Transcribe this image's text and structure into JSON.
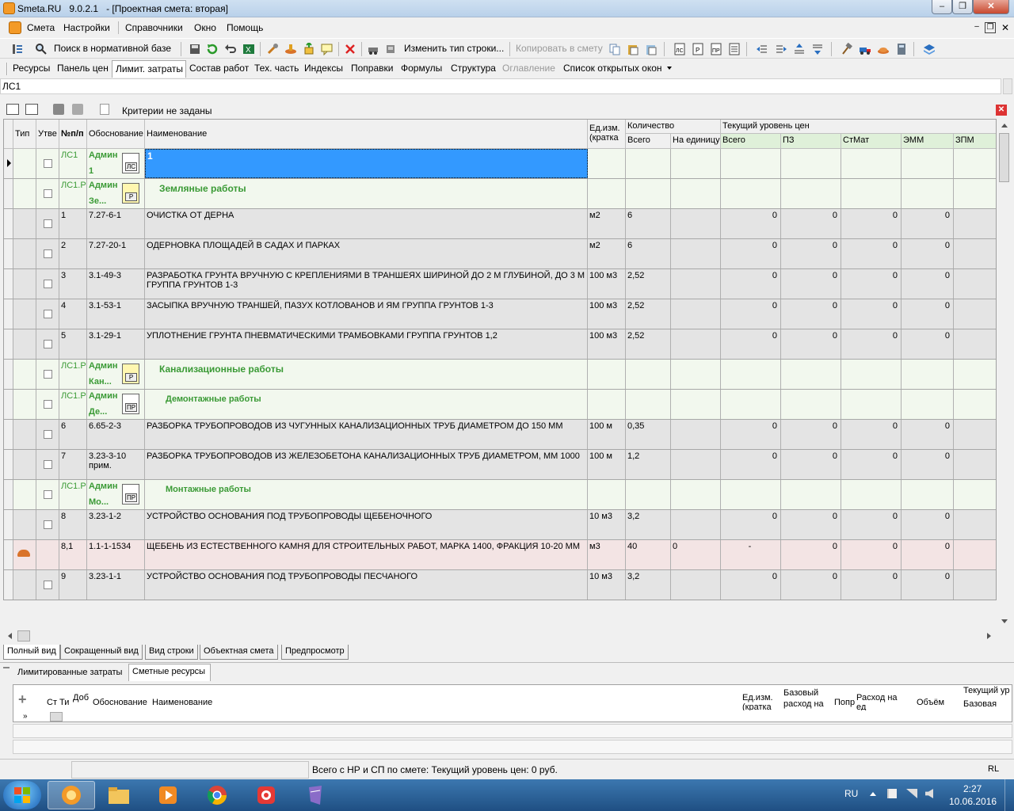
{
  "window": {
    "app_name": "Smeta.RU",
    "version": "9.0.2.1",
    "doc_title": "- [Проектная смета: вторая]"
  },
  "menu": [
    "Смета",
    "Настройки",
    "Справочники",
    "Окно",
    "Помощь"
  ],
  "toolbar": {
    "search_label": "Поиск в нормативной базе",
    "change_row_type_label": "Изменить тип строки...",
    "copy_to_estimate_label": "Копировать в смету"
  },
  "tabs_top": [
    "Ресурсы",
    "Панель цен",
    "Лимит. затраты",
    "Состав работ",
    "Тех. часть",
    "Индексы",
    "Поправки",
    "Формулы",
    "Структура",
    "Оглавление",
    "Список открытых окон"
  ],
  "address_value": "ЛС1",
  "grid_toolbar": {
    "criteria": "Критерии не заданы"
  },
  "headers": {
    "type": "Тип",
    "approved": "Утве",
    "num": "№п/п",
    "basis": "Обоснование",
    "name": "Наименование",
    "unit": "Ед.изм.",
    "unit_short": "(кратка",
    "quantity": "Количество",
    "qty_total": "Всего",
    "qty_per_unit": "На единицу",
    "price_level": "Текущий уровень цен",
    "price_total": "Всего",
    "pz": "ПЗ",
    "stmat": "СтМат",
    "emm": "ЭММ",
    "zpm": "ЗПМ"
  },
  "rows": [
    {
      "kind": "section",
      "code": "ЛС1",
      "admin": "Админ",
      "sub": "1",
      "title": "1",
      "selected": true,
      "icon": "LS"
    },
    {
      "kind": "section",
      "code": "ЛС1.Р",
      "admin": "Админ",
      "sub": "Зе...",
      "title": "Земляные работы",
      "icon": "Р"
    },
    {
      "kind": "item",
      "num": "1",
      "basis": "7.27-6-1",
      "name": "ОЧИСТКА ОТ ДЕРНА",
      "unit": "м2",
      "qty": "6",
      "v1": "0",
      "v2": "0",
      "v3": "0",
      "v4": "0"
    },
    {
      "kind": "item",
      "num": "2",
      "basis": "7.27-20-1",
      "name": "ОДЕРНОВКА ПЛОЩАДЕЙ В САДАХ И ПАРКАХ",
      "unit": "м2",
      "qty": "6",
      "v1": "0",
      "v2": "0",
      "v3": "0",
      "v4": "0"
    },
    {
      "kind": "item",
      "num": "3",
      "basis": "3.1-49-3",
      "name": "РАЗРАБОТКА ГРУНТА ВРУЧНУЮ С КРЕПЛЕНИЯМИ В ТРАНШЕЯХ ШИРИНОЙ ДО 2 М ГЛУБИНОЙ, ДО 3 М ГРУППА ГРУНТОВ 1-3",
      "unit": "100 м3",
      "qty": "2,52",
      "v1": "0",
      "v2": "0",
      "v3": "0",
      "v4": "0"
    },
    {
      "kind": "item",
      "num": "4",
      "basis": "3.1-53-1",
      "name": "ЗАСЫПКА ВРУЧНУЮ ТРАНШЕЙ, ПАЗУХ КОТЛОВАНОВ И ЯМ ГРУППА ГРУНТОВ 1-3",
      "unit": "100 м3",
      "qty": "2,52",
      "v1": "0",
      "v2": "0",
      "v3": "0",
      "v4": "0"
    },
    {
      "kind": "item",
      "num": "5",
      "basis": "3.1-29-1",
      "name": "УПЛОТНЕНИЕ ГРУНТА ПНЕВМАТИЧЕСКИМИ ТРАМБОВКАМИ ГРУППА ГРУНТОВ 1,2",
      "unit": "100 м3",
      "qty": "2,52",
      "v1": "0",
      "v2": "0",
      "v3": "0",
      "v4": "0"
    },
    {
      "kind": "section",
      "code": "ЛС1.Р",
      "admin": "Админ",
      "sub": "Кан...",
      "title": "Канализационные работы",
      "icon": "Р"
    },
    {
      "kind": "section",
      "code": "ЛС1.Р",
      "admin": "Админ",
      "sub": "Де...",
      "title": "Демонтажные работы",
      "icon": "ПР",
      "small": true
    },
    {
      "kind": "item",
      "num": "6",
      "basis": "6.65-2-3",
      "name": "РАЗБОРКА ТРУБОПРОВОДОВ ИЗ ЧУГУННЫХ КАНАЛИЗАЦИОННЫХ ТРУБ ДИАМЕТРОМ ДО 150 ММ",
      "unit": "100 м",
      "qty": "0,35",
      "v1": "0",
      "v2": "0",
      "v3": "0",
      "v4": "0"
    },
    {
      "kind": "item",
      "num": "7",
      "basis": "3.23-3-10 прим.",
      "name": "РАЗБОРКА ТРУБОПРОВОДОВ ИЗ ЖЕЛЕЗОБЕТОНА КАНАЛИЗАЦИОННЫХ ТРУБ ДИАМЕТРОМ, ММ 1000",
      "unit": "100 м",
      "qty": "1,2",
      "v1": "0",
      "v2": "0",
      "v3": "0",
      "v4": "0"
    },
    {
      "kind": "section",
      "code": "ЛС1.Р",
      "admin": "Админ",
      "sub": "Мо...",
      "title": "Монтажные работы",
      "icon": "ПР",
      "small": true
    },
    {
      "kind": "item",
      "num": "8",
      "basis": "3.23-1-2",
      "name": "УСТРОЙСТВО ОСНОВАНИЯ ПОД ТРУБОПРОВОДЫ ЩЕБЕНОЧНОГО",
      "unit": "10 м3",
      "qty": "3,2",
      "v1": "0",
      "v2": "0",
      "v3": "0",
      "v4": "0"
    },
    {
      "kind": "resource",
      "num": "8,1",
      "basis": "1.1-1-1534",
      "name": "ЩЕБЕНЬ ИЗ ЕСТЕСТВЕННОГО КАМНЯ ДЛЯ СТРОИТЕЛЬНЫХ РАБОТ, МАРКА 1400, ФРАКЦИЯ 10-20 ММ",
      "unit": "м3",
      "qty": "40",
      "perunit": "0",
      "v1": "-",
      "v2": "0",
      "v3": "0",
      "v4": "0"
    },
    {
      "kind": "item",
      "num": "9",
      "basis": "3.23-1-1",
      "name": "УСТРОЙСТВО ОСНОВАНИЯ ПОД ТРУБОПРОВОДЫ ПЕСЧАНОГО",
      "unit": "10 м3",
      "qty": "3,2",
      "v1": "0",
      "v2": "0",
      "v3": "0",
      "v4": "0"
    }
  ],
  "bottom_tabs": [
    "Полный вид",
    "Сокращенный вид",
    "Вид строки",
    "Объектная смета",
    "Предпросмотр"
  ],
  "lower_tabs": [
    "Лимитированные затраты",
    "Сметные ресурсы"
  ],
  "lower_headers": {
    "st": "Ст",
    "t": "Ти",
    "dob": "Доб",
    "basis": "Обоснование",
    "name": "Наименование",
    "unit": "Ед.изм.",
    "unit_short": "(кратка",
    "base_rate": "Базовый",
    "base_rate2": "расход на",
    "corr": "Попр",
    "rate": "Расход на",
    "rate2": "ед",
    "volume": "Объём",
    "cur": "Текущий ур",
    "base": "Базовая"
  },
  "status": {
    "total": "Всего с НР и СП по смете: Текущий уровень цен: 0 руб.",
    "lang": "RL"
  },
  "taskbar": {
    "lang": "RU",
    "time": "2:27",
    "date": "10.06.2016"
  },
  "colors": {
    "accent_green": "#3a9a35",
    "selected_blue": "#3399ff",
    "section_bg": "#f2f8ee",
    "item_bg": "#e4e4e4",
    "resource_bg": "#f3e4e4"
  }
}
